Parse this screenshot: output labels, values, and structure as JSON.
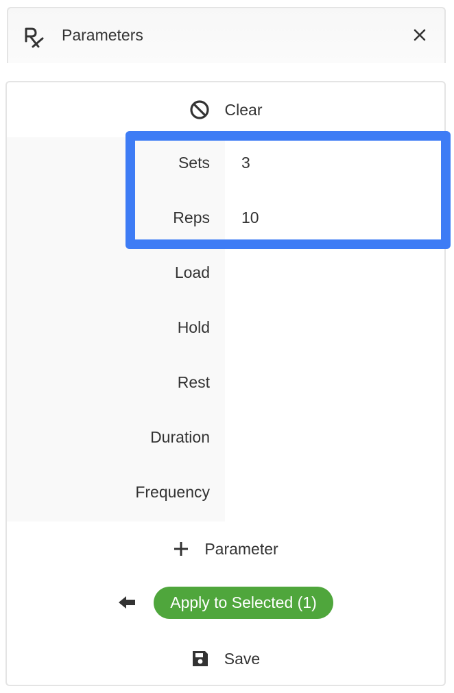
{
  "header": {
    "title": "Parameters",
    "rx_icon": "prescription-rx-icon",
    "close_icon": "close-icon"
  },
  "actions": {
    "clear_label": "Clear",
    "add_parameter_label": "Parameter",
    "apply_label": "Apply to Selected (1)",
    "save_label": "Save"
  },
  "parameters": [
    {
      "label": "Sets",
      "value": "3"
    },
    {
      "label": "Reps",
      "value": "10"
    },
    {
      "label": "Load",
      "value": ""
    },
    {
      "label": "Hold",
      "value": ""
    },
    {
      "label": "Rest",
      "value": ""
    },
    {
      "label": "Duration",
      "value": ""
    },
    {
      "label": "Frequency",
      "value": ""
    }
  ],
  "colors": {
    "accent_highlight": "#3e7cf5",
    "apply_green": "#4fa63c",
    "text": "#333333"
  }
}
